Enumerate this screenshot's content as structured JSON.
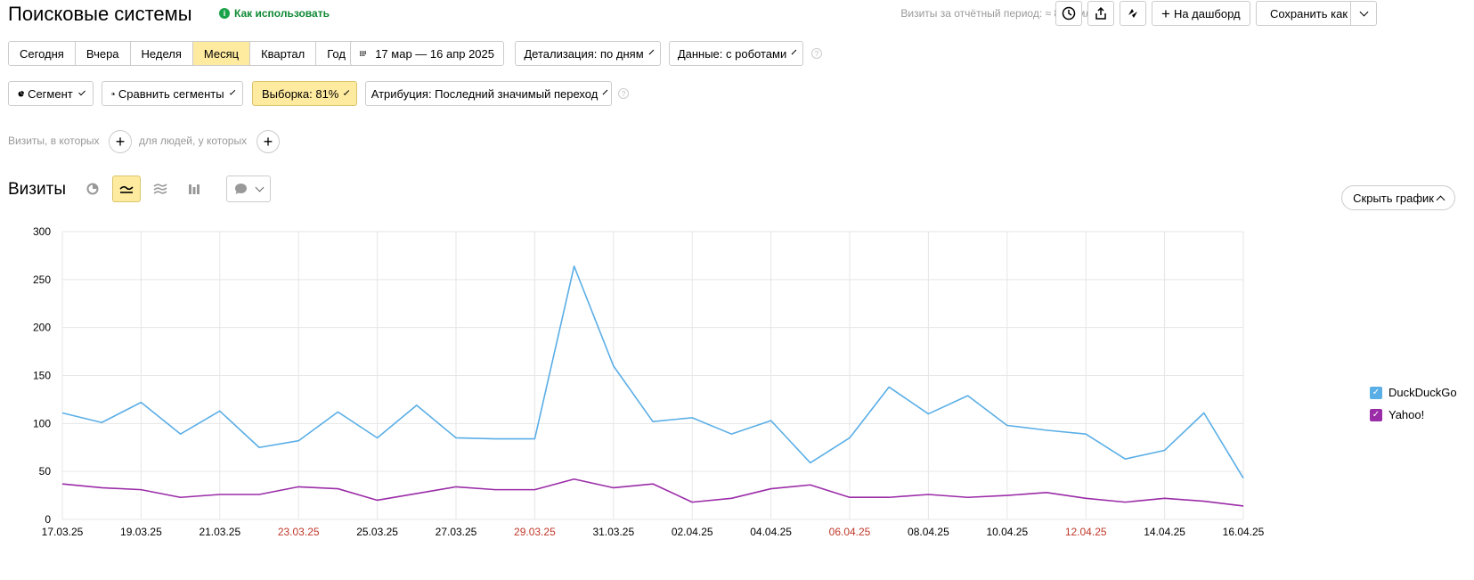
{
  "page": {
    "title": "Поисковые системы",
    "howto_label": "Как использовать",
    "howto_icon": "i",
    "visits_period": "Визиты за отчётный период: ≈ 8,74 млн"
  },
  "toolbar": {
    "dashboard_label": "На дашборд",
    "save_as_label": "Сохранить как"
  },
  "periods": [
    {
      "label": "Сегодня",
      "active": false
    },
    {
      "label": "Вчера",
      "active": false
    },
    {
      "label": "Неделя",
      "active": false
    },
    {
      "label": "Месяц",
      "active": true
    },
    {
      "label": "Квартал",
      "active": false
    },
    {
      "label": "Год",
      "active": false
    }
  ],
  "date_range": "17 мар — 16 апр 2025",
  "detail_label": "Детализация: по дням",
  "data_label": "Данные: с роботами",
  "segment_label": "Сегмент",
  "compare_label": "Сравнить сегменты",
  "sample_label": "Выборка: 81%",
  "attribution_label": "Атрибуция: Последний значимый переход",
  "filters": {
    "visits_label": "Визиты, в которых",
    "people_label": "для людей, у которых"
  },
  "chart_section": {
    "title": "Визиты",
    "hide_label": "Скрыть график"
  },
  "colors": {
    "duckduckgo": "#5aaee6",
    "yahoo": "#9b2ca8",
    "weekend": "#c0392b",
    "accent": "#ffeba0"
  },
  "chart_data": {
    "type": "line",
    "ylim": [
      0,
      300
    ],
    "yticks": [
      0,
      50,
      100,
      150,
      200,
      250,
      300
    ],
    "x": [
      "17.03.25",
      "18.03.25",
      "19.03.25",
      "20.03.25",
      "21.03.25",
      "22.03.25",
      "23.03.25",
      "24.03.25",
      "25.03.25",
      "26.03.25",
      "27.03.25",
      "28.03.25",
      "29.03.25",
      "30.03.25",
      "31.03.25",
      "01.04.25",
      "02.04.25",
      "03.04.25",
      "04.04.25",
      "05.04.25",
      "06.04.25",
      "07.04.25",
      "08.04.25",
      "09.04.25",
      "10.04.25",
      "11.04.25",
      "12.04.25",
      "13.04.25",
      "14.04.25",
      "15.04.25",
      "16.04.25"
    ],
    "xtick_labels": [
      {
        "label": "17.03.25",
        "index": 0,
        "weekend": false
      },
      {
        "label": "19.03.25",
        "index": 2,
        "weekend": false
      },
      {
        "label": "21.03.25",
        "index": 4,
        "weekend": false
      },
      {
        "label": "23.03.25",
        "index": 6,
        "weekend": true
      },
      {
        "label": "25.03.25",
        "index": 8,
        "weekend": false
      },
      {
        "label": "27.03.25",
        "index": 10,
        "weekend": false
      },
      {
        "label": "29.03.25",
        "index": 12,
        "weekend": true
      },
      {
        "label": "31.03.25",
        "index": 14,
        "weekend": false
      },
      {
        "label": "02.04.25",
        "index": 16,
        "weekend": false
      },
      {
        "label": "04.04.25",
        "index": 18,
        "weekend": false
      },
      {
        "label": "06.04.25",
        "index": 20,
        "weekend": true
      },
      {
        "label": "08.04.25",
        "index": 22,
        "weekend": false
      },
      {
        "label": "10.04.25",
        "index": 24,
        "weekend": false
      },
      {
        "label": "12.04.25",
        "index": 26,
        "weekend": true
      },
      {
        "label": "14.04.25",
        "index": 28,
        "weekend": false
      },
      {
        "label": "16.04.25",
        "index": 30,
        "weekend": false
      }
    ],
    "series": [
      {
        "name": "DuckDuckGo",
        "values": [
          111,
          101,
          122,
          89,
          113,
          75,
          82,
          112,
          85,
          119,
          85,
          84,
          84,
          264,
          160,
          102,
          106,
          89,
          103,
          59,
          85,
          138,
          110,
          129,
          98,
          93,
          89,
          63,
          72,
          111,
          43
        ]
      },
      {
        "name": "Yahoo!",
        "values": [
          37,
          33,
          31,
          23,
          26,
          26,
          34,
          32,
          20,
          27,
          34,
          31,
          31,
          42,
          33,
          37,
          18,
          22,
          32,
          36,
          23,
          23,
          26,
          23,
          25,
          28,
          22,
          18,
          22,
          19,
          14
        ]
      }
    ],
    "grid": true,
    "legend": "right"
  }
}
